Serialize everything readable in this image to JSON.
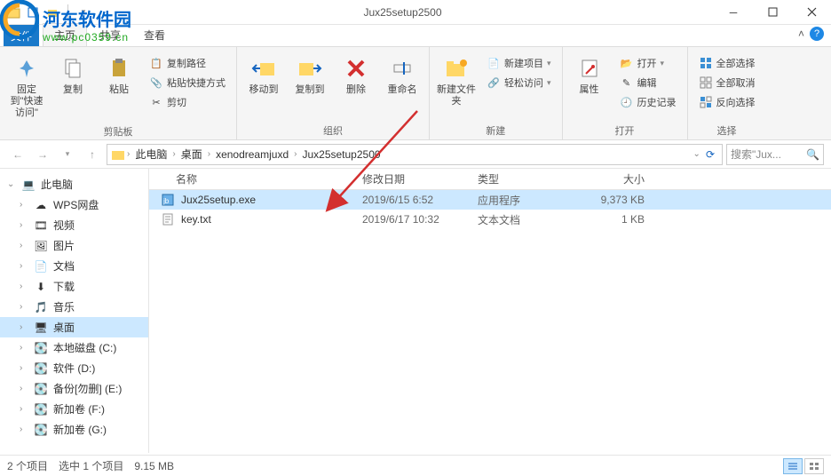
{
  "watermark": {
    "title": "河东软件园",
    "url": "www.pc0359.cn"
  },
  "window": {
    "title": "Jux25setup2500"
  },
  "tabs": {
    "file": "文件",
    "home": "主页",
    "share": "共享",
    "view": "查看"
  },
  "ribbon": {
    "clipboard": {
      "pin": "固定到\"快速访问\"",
      "copy": "复制",
      "paste": "粘贴",
      "copypath": "复制路径",
      "pasteshortcut": "粘贴快捷方式",
      "cut": "剪切",
      "label": "剪贴板"
    },
    "organize": {
      "moveto": "移动到",
      "copyto": "复制到",
      "delete": "删除",
      "rename": "重命名",
      "label": "组织"
    },
    "new": {
      "newfolder": "新建文件夹",
      "newitem": "新建项目",
      "easyaccess": "轻松访问",
      "label": "新建"
    },
    "open": {
      "properties": "属性",
      "open": "打开",
      "edit": "编辑",
      "history": "历史记录",
      "label": "打开"
    },
    "select": {
      "selectall": "全部选择",
      "selectnone": "全部取消",
      "invert": "反向选择",
      "label": "选择"
    }
  },
  "breadcrumb": {
    "c0": "此电脑",
    "c1": "桌面",
    "c2": "xenodreamjuxd",
    "c3": "Jux25setup2500"
  },
  "search": {
    "placeholder": "搜索\"Jux..."
  },
  "tree": {
    "thispc": "此电脑",
    "wps": "WPS网盘",
    "videos": "视频",
    "pictures": "图片",
    "documents": "文档",
    "downloads": "下载",
    "music": "音乐",
    "desktop": "桌面",
    "diskc": "本地磁盘 (C:)",
    "diskd": "软件 (D:)",
    "diske": "备份[勿删] (E:)",
    "diskf": "新加卷 (F:)",
    "diskg": "新加卷 (G:)"
  },
  "columns": {
    "name": "名称",
    "date": "修改日期",
    "type": "类型",
    "size": "大小"
  },
  "files": [
    {
      "name": "Jux25setup.exe",
      "date": "2019/6/15 6:52",
      "type": "应用程序",
      "size": "9,373 KB"
    },
    {
      "name": "key.txt",
      "date": "2019/6/17 10:32",
      "type": "文本文档",
      "size": "1 KB"
    }
  ],
  "status": {
    "count": "2 个项目",
    "selected": "选中 1 个项目",
    "size": "9.15 MB"
  }
}
